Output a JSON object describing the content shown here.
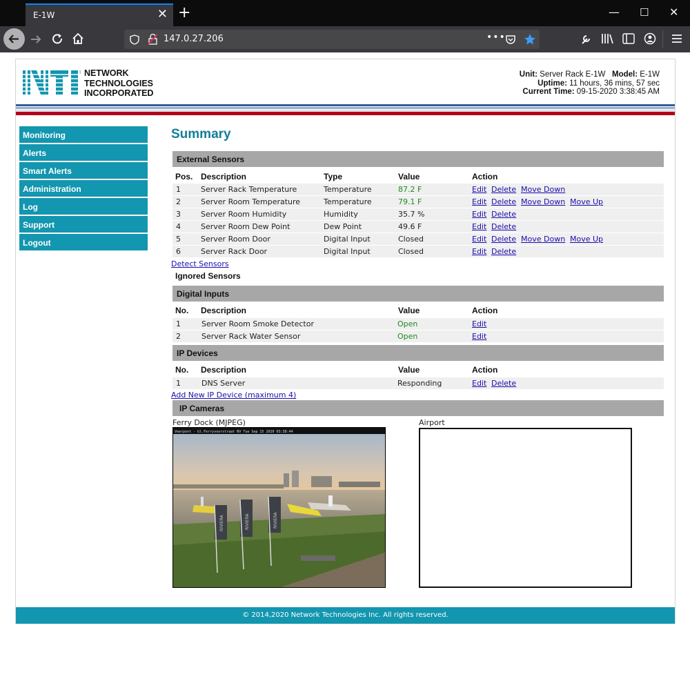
{
  "browser": {
    "tab_title": "E-1W",
    "url": "147.0.27.206"
  },
  "header": {
    "logo_text": "NTI",
    "company_line1": "NETWORK",
    "company_line2": "TECHNOLOGIES",
    "company_line3": "INCORPORATED",
    "unit_label": "Unit:",
    "unit_value": "Server Rack E-1W",
    "model_label": "Model:",
    "model_value": "E-1W",
    "uptime_label": "Uptime:",
    "uptime_value": "11 hours, 36 mins, 57 sec",
    "time_label": "Current Time:",
    "time_value": "09-15-2020 3:38:45 AM"
  },
  "sidebar": {
    "items": [
      {
        "label": "Monitoring"
      },
      {
        "label": "Alerts"
      },
      {
        "label": "Smart Alerts"
      },
      {
        "label": "Administration"
      },
      {
        "label": "Log"
      },
      {
        "label": "Support"
      },
      {
        "label": "Logout"
      }
    ]
  },
  "main": {
    "title": "Summary",
    "external": {
      "heading": "External Sensors",
      "cols": {
        "pos": "Pos.",
        "desc": "Description",
        "type": "Type",
        "value": "Value",
        "action": "Action"
      },
      "rows": [
        {
          "pos": "1",
          "desc": "Server Rack Temperature",
          "type": "Temperature",
          "value": "87.2 F"
        },
        {
          "pos": "2",
          "desc": "Server Room Temperature",
          "type": "Temperature",
          "value": "79.1 F"
        },
        {
          "pos": "3",
          "desc": "Server Room Humidity",
          "type": "Humidity",
          "value": "35.7 %"
        },
        {
          "pos": "4",
          "desc": "Server Room Dew Point",
          "type": "Dew Point",
          "value": "49.6 F"
        },
        {
          "pos": "5",
          "desc": "Server Room Door",
          "type": "Digital Input",
          "value": "Closed"
        },
        {
          "pos": "6",
          "desc": "Server Rack Door",
          "type": "Digital Input",
          "value": "Closed"
        }
      ],
      "value_colors": [
        "#1e8a1e",
        "#1e8a1e",
        "#222222",
        "#222222",
        "#222222",
        "#222222"
      ],
      "detect_link": "Detect Sensors",
      "ignored": "Ignored Sensors"
    },
    "actions": {
      "edit": "Edit",
      "delete": "Delete",
      "move_down": "Move Down",
      "move_up": "Move Up"
    },
    "digital": {
      "heading": "Digital Inputs",
      "cols": {
        "no": "No.",
        "desc": "Description",
        "value": "Value",
        "action": "Action"
      },
      "rows": [
        {
          "no": "1",
          "desc": "Server Room Smoke Detector",
          "value": "Open"
        },
        {
          "no": "2",
          "desc": "Server Rack Water Sensor",
          "value": "Open"
        }
      ]
    },
    "ip_devices": {
      "heading": "IP Devices",
      "cols": {
        "no": "No.",
        "desc": "Description",
        "value": "Value",
        "action": "Action"
      },
      "rows": [
        {
          "no": "1",
          "desc": "DNS Server",
          "value": "Responding"
        }
      ],
      "add_link": "Add New IP Device (maximum 4)"
    },
    "cameras": {
      "heading": "IP Cameras",
      "cam1_label": "Ferry Dock (MJPEG)",
      "cam1_overlay": "Veerpont - Gl.Ferryvoorstraat NV Tue Sep 15 2020 03:38:44",
      "cam1_flag_text": "RIVIERA",
      "cam2_label": "Airport"
    }
  },
  "footer": {
    "text": "© 2014,2020 Network Technologies Inc. All rights reserved."
  }
}
